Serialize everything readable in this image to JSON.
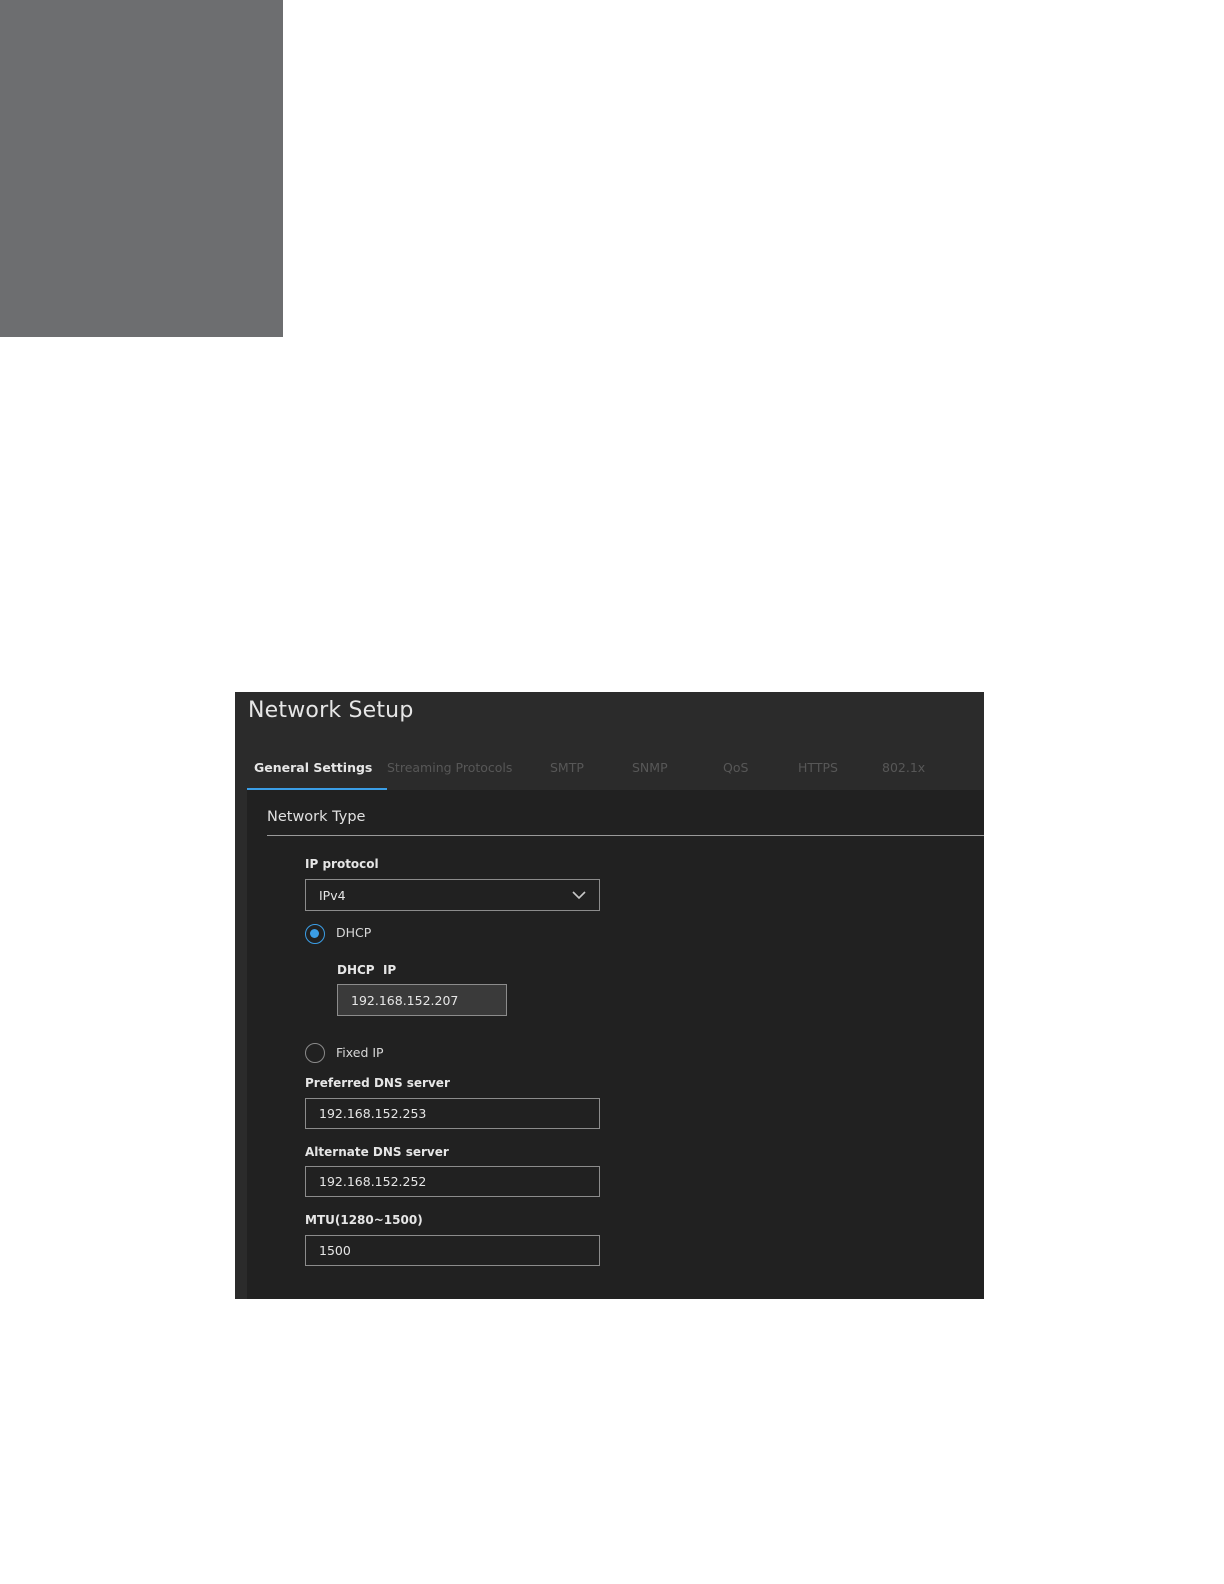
{
  "header": {
    "title": "Network Setup"
  },
  "tabs": [
    {
      "label": "General Settings",
      "active": true
    },
    {
      "label": "Streaming Protocols",
      "active": false
    },
    {
      "label": "SMTP",
      "active": false
    },
    {
      "label": "SNMP",
      "active": false
    },
    {
      "label": "QoS",
      "active": false
    },
    {
      "label": "HTTPS",
      "active": false
    },
    {
      "label": "802.1x",
      "active": false
    }
  ],
  "network_type": {
    "section_title": "Network Type",
    "ip_protocol": {
      "label": "IP protocol",
      "selected": "IPv4"
    },
    "dhcp": {
      "label": "DHCP",
      "checked": true,
      "ip_label_prefix": "DHCP",
      "ip_label_suffix": "IP",
      "ip_value": "192.168.152.207"
    },
    "fixed_ip": {
      "label": "Fixed IP",
      "checked": false
    },
    "preferred_dns": {
      "label": "Preferred DNS server",
      "value": "192.168.152.253"
    },
    "alternate_dns": {
      "label": "Alternate DNS server",
      "value": "192.168.152.252"
    },
    "mtu": {
      "label": "MTU(1280~1500)",
      "value": "1500"
    }
  },
  "colors": {
    "accent": "#3b9ee6",
    "panel_background": "#212121",
    "header_background": "#2b2b2b",
    "corner_block": "#6d6e70"
  }
}
